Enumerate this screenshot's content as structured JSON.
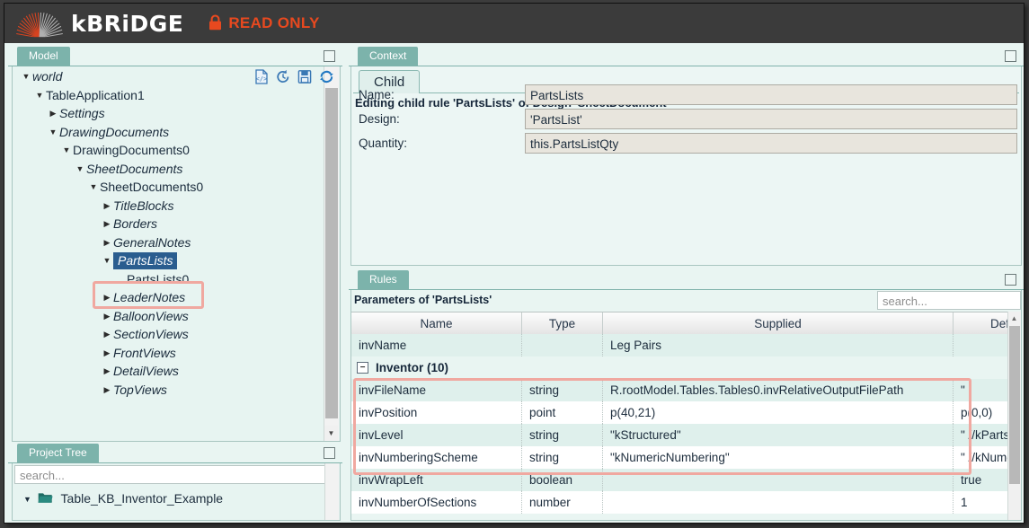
{
  "app": {
    "brand": "kBRiDGE",
    "status_badge": "READ ONLY",
    "lock_icon": "lock-icon",
    "brand_color": "#ffffff",
    "status_color": "#e8491f",
    "header_bg": "#3b3b3b",
    "accent_color": "#7cb3ab",
    "selection_color": "#2a5d8f",
    "annotation_color": "#f0a8a0"
  },
  "model_panel": {
    "tab_label": "Model",
    "restore_icon": "restore-icon",
    "toolbar": [
      {
        "name": "view-source-icon",
        "title": "code"
      },
      {
        "name": "history-icon",
        "title": "history"
      },
      {
        "name": "save-icon",
        "title": "save"
      },
      {
        "name": "refresh-icon",
        "title": "refresh"
      }
    ],
    "tree": [
      {
        "label": "world",
        "depth": 0,
        "state": "expanded",
        "italic": true,
        "selected": false
      },
      {
        "label": "TableApplication1",
        "depth": 1,
        "state": "expanded",
        "italic": false,
        "selected": false
      },
      {
        "label": "Settings",
        "depth": 2,
        "state": "collapsed",
        "italic": true,
        "selected": false
      },
      {
        "label": "DrawingDocuments",
        "depth": 2,
        "state": "expanded",
        "italic": true,
        "selected": false
      },
      {
        "label": "DrawingDocuments0",
        "depth": 3,
        "state": "expanded",
        "italic": false,
        "selected": false
      },
      {
        "label": "SheetDocuments",
        "depth": 4,
        "state": "expanded",
        "italic": true,
        "selected": false
      },
      {
        "label": "SheetDocuments0",
        "depth": 5,
        "state": "expanded",
        "italic": false,
        "selected": false
      },
      {
        "label": "TitleBlocks",
        "depth": 6,
        "state": "collapsed",
        "italic": true,
        "selected": false
      },
      {
        "label": "Borders",
        "depth": 6,
        "state": "collapsed",
        "italic": true,
        "selected": false
      },
      {
        "label": "GeneralNotes",
        "depth": 6,
        "state": "collapsed",
        "italic": true,
        "selected": false
      },
      {
        "label": "PartsLists",
        "depth": 6,
        "state": "expanded",
        "italic": true,
        "selected": true
      },
      {
        "label": "PartsLists0",
        "depth": 7,
        "state": "none",
        "italic": false,
        "selected": false
      },
      {
        "label": "LeaderNotes",
        "depth": 6,
        "state": "collapsed",
        "italic": true,
        "selected": false
      },
      {
        "label": "BalloonViews",
        "depth": 6,
        "state": "collapsed",
        "italic": true,
        "selected": false
      },
      {
        "label": "SectionViews",
        "depth": 6,
        "state": "collapsed",
        "italic": true,
        "selected": false
      },
      {
        "label": "FrontViews",
        "depth": 6,
        "state": "collapsed",
        "italic": true,
        "selected": false
      },
      {
        "label": "DetailViews",
        "depth": 6,
        "state": "collapsed",
        "italic": true,
        "selected": false
      },
      {
        "label": "TopViews",
        "depth": 6,
        "state": "collapsed",
        "italic": true,
        "selected": false
      }
    ]
  },
  "project_panel": {
    "tab_label": "Project Tree",
    "restore_icon": "restore-icon",
    "search_placeholder": "search...",
    "search_value": "",
    "root_item": "Table_KB_Inventor_Example",
    "folder_icon": "folder-open-icon"
  },
  "context_panel": {
    "tab_label": "Context",
    "restore_icon": "restore-icon",
    "sub_tab": "Child",
    "heading": "Editing child rule 'PartsLists' of Design 'SheetDocument'",
    "fields": [
      {
        "label": "Name:",
        "value": "PartsLists"
      },
      {
        "label": "Design:",
        "value": "'PartsList'"
      },
      {
        "label": "Quantity:",
        "value": "this.PartsListQty"
      }
    ]
  },
  "rules_panel": {
    "tab_label": "Rules",
    "restore_icon": "restore-icon",
    "caption": "Parameters of 'PartsLists'",
    "search_placeholder": "search...",
    "search_value": "",
    "columns": [
      "Name",
      "Type",
      "Supplied",
      "Def"
    ],
    "rows": [
      {
        "kind": "data",
        "name": "invName",
        "type": "",
        "supplied": "Leg Pairs",
        "details": ""
      },
      {
        "kind": "group",
        "name": "Inventor (10)",
        "type": "",
        "supplied": "",
        "details": ""
      },
      {
        "kind": "data",
        "name": "invFileName",
        "type": "string",
        "supplied": "R.rootModel.Tables.Tables0.invRelativeOutputFilePath",
        "details": "\""
      },
      {
        "kind": "data",
        "name": "invPosition",
        "type": "point",
        "supplied": "p(40,21)",
        "details": "p(0,0)"
      },
      {
        "kind": "data",
        "name": "invLevel",
        "type": "string",
        "supplied": "\"kStructured\"",
        "details": "\" //kParts"
      },
      {
        "kind": "data",
        "name": "invNumberingScheme",
        "type": "string",
        "supplied": "\"kNumericNumbering\"",
        "details": "\" //kNume"
      },
      {
        "kind": "data",
        "name": "invWrapLeft",
        "type": "boolean",
        "supplied": "",
        "details": "true"
      },
      {
        "kind": "data",
        "name": "invNumberOfSections",
        "type": "number",
        "supplied": "",
        "details": "1"
      }
    ]
  },
  "annotations": [
    {
      "name": "annotation-partslists-node",
      "target": "PartsLists"
    },
    {
      "name": "annotation-inventor-params",
      "target": "Inventor parameter rows"
    }
  ]
}
